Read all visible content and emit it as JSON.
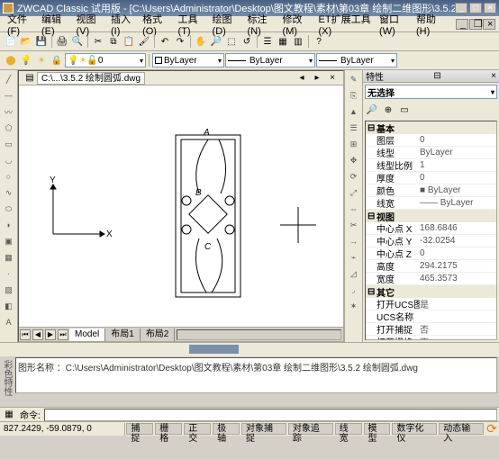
{
  "title": "ZWCAD Classic 试用版 - [C:\\Users\\Administrator\\Desktop\\图文教程\\素材\\第03章 绘制二维图形\\3.5.2  绘制圆弧.dwg]",
  "menu": [
    "文件(F)",
    "编辑(E)",
    "视图(V)",
    "插入(I)",
    "格式(O)",
    "工具(T)",
    "绘图(D)",
    "标注(N)",
    "修改(M)",
    "ET扩展工具(X)",
    "窗口(W)",
    "帮助(H)"
  ],
  "doc_tab": "C:\\...\\3.5.2  绘制圆弧.dwg",
  "layer_combo": "ByLayer",
  "linetype_combo": "ByLayer",
  "layer0": "0",
  "sheet_tabs": [
    "Model",
    "布局1",
    "布局2"
  ],
  "cmd_history": "图形名称 ：C:\\Users\\Administrator\\Desktop\\图文教程\\素材\\第03章 绘制二维图形\\3.5.2  绘制圆弧.dwg",
  "cmd_prompt": "命令:",
  "coords": "827.2429, -59.0879, 0",
  "status_btns": [
    "捕捉",
    "栅格",
    "正交",
    "极轴",
    "对象捕捉",
    "对象追踪",
    "线宽",
    "模型",
    "数字化仪",
    "动态输入"
  ],
  "prop": {
    "title": "特性",
    "noselect": "无选择",
    "groups": {
      "basic": {
        "label": "基本",
        "rows": [
          {
            "k": "图层",
            "v": "0"
          },
          {
            "k": "线型",
            "v": "ByLayer"
          },
          {
            "k": "线型比例",
            "v": "1"
          },
          {
            "k": "厚度",
            "v": "0"
          },
          {
            "k": "颜色",
            "v": "■ ByLayer"
          },
          {
            "k": "线宽",
            "v": "—— ByLayer"
          }
        ]
      },
      "view": {
        "label": "视图",
        "rows": [
          {
            "k": "中心点 X",
            "v": "168.6846"
          },
          {
            "k": "中心点 Y",
            "v": "-32.0254"
          },
          {
            "k": "中心点 Z",
            "v": "0"
          },
          {
            "k": "高度",
            "v": "294.2175"
          },
          {
            "k": "宽度",
            "v": "465.3573"
          }
        ]
      },
      "other": {
        "label": "其它",
        "rows": [
          {
            "k": "打开UCS图标",
            "v": "是"
          },
          {
            "k": "UCS名称",
            "v": ""
          },
          {
            "k": "打开捕捉",
            "v": "否"
          },
          {
            "k": "打开栅格",
            "v": "否"
          }
        ]
      }
    }
  },
  "axis": {
    "x": "X",
    "y": "Y"
  },
  "door_labels": {
    "a": "A",
    "b": "B",
    "c": "C"
  },
  "side_label": "彩色特性"
}
